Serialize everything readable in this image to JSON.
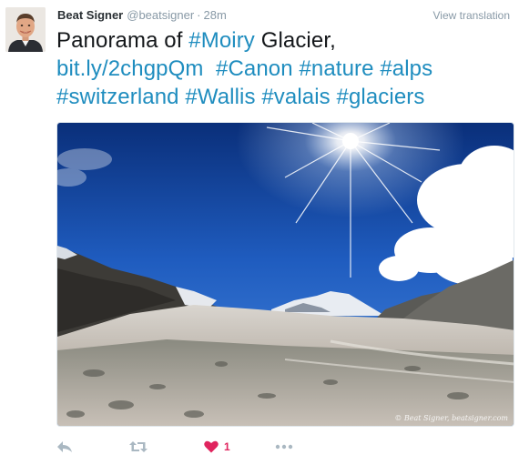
{
  "tweet": {
    "author_name": "Beat Signer",
    "author_handle": "@beatsigner",
    "separator": "·",
    "time": "28m",
    "view_translation": "View translation",
    "text": {
      "l1_plain1": "Panorama of ",
      "l1_tag": "#Moiry",
      "l1_plain2": " Glacier,",
      "l2_link": "bit.ly/2chgpQm",
      "l2_tag1": "#Canon",
      "l2_tag2": "#nature",
      "l2_tag3": "#alps",
      "l3_tag1": "#switzerland",
      "l3_tag2": "#Wallis",
      "l3_tag3": "#valais",
      "l3_tag4": "#glaciers"
    },
    "photo_watermark": "© Beat Signer, beatsigner.com",
    "like_count": "1",
    "colors": {
      "link": "#1f8dbf",
      "like": "#e0245e",
      "icon_gray": "#aab8c2"
    },
    "icons": [
      "reply-icon",
      "retweet-icon",
      "heart-icon",
      "more-icon"
    ]
  }
}
